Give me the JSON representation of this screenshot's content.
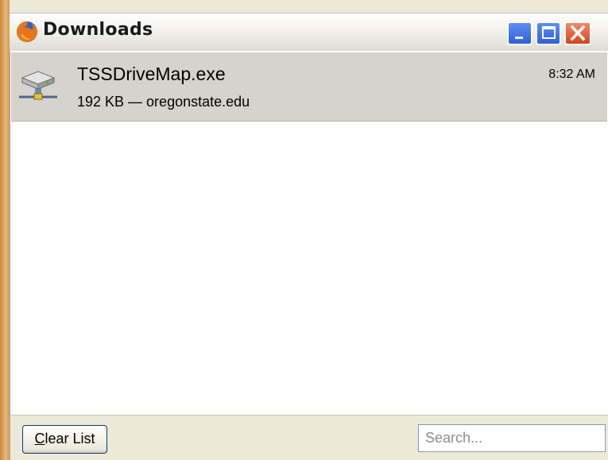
{
  "window": {
    "title": "Downloads",
    "icon": "firefox-icon",
    "controls": [
      "minimize-icon",
      "maximize-icon",
      "close-icon"
    ]
  },
  "downloads": [
    {
      "filename": "TSSDriveMap.exe",
      "time": "8:32 AM",
      "meta": "192 KB — oregonstate.edu",
      "icon": "network-drive-icon"
    }
  ],
  "footer": {
    "clear_prefix": "C",
    "clear_rest": "lear List",
    "search_placeholder": "Search...",
    "search_value": ""
  },
  "colors": {
    "selected_row": "#d6d3ce",
    "close_button": "#d6431b",
    "window_button": "#2f5fd8"
  }
}
